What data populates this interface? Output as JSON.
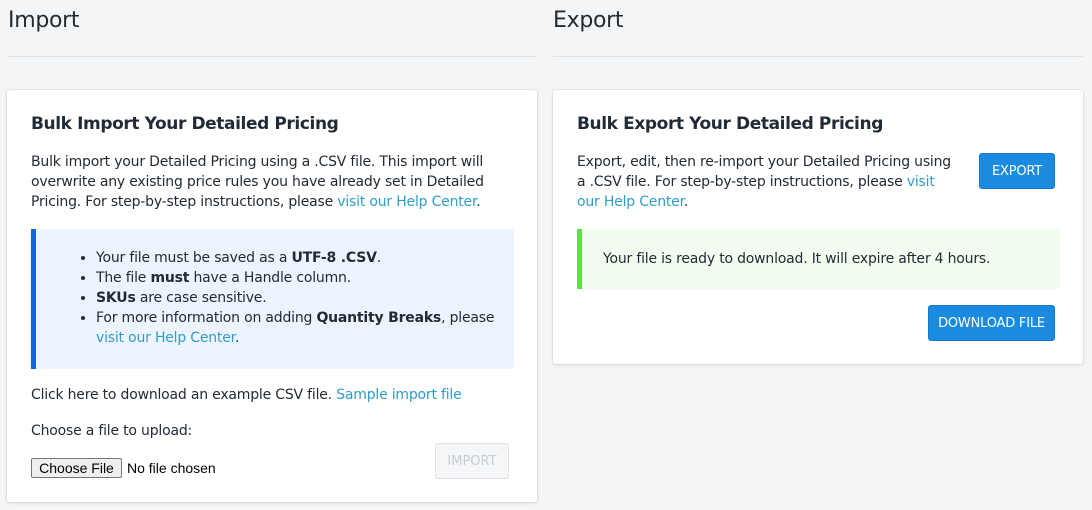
{
  "import": {
    "section_title": "Import",
    "card_title": "Bulk Import Your Detailed Pricing",
    "intro_text": "Bulk import your Detailed Pricing using a .CSV file. This import will overwrite any existing price rules you have already set in Detailed Pricing. For step-by-step instructions, please ",
    "intro_link": "visit our Help Center",
    "intro_end": ".",
    "bullets": {
      "b1_pre": "Your file must be saved as a ",
      "b1_bold": "UTF-8 .CSV",
      "b1_post": ".",
      "b2_pre": "The file ",
      "b2_bold": "must",
      "b2_post": " have a Handle column.",
      "b3_bold": "SKUs",
      "b3_post": " are case sensitive.",
      "b4_pre": "For more information on adding ",
      "b4_bold": "Quantity Breaks",
      "b4_post": ", please ",
      "b4_link": "visit our Help Center",
      "b4_end": "."
    },
    "sample_text": "Click here to download an example CSV file. ",
    "sample_link": "Sample import file",
    "upload_label": "Choose a file to upload:",
    "choose_file_label": "Choose File",
    "file_status": "No file chosen",
    "import_button": "IMPORT"
  },
  "export": {
    "section_title": "Export",
    "card_title": "Bulk Export Your Detailed Pricing",
    "intro_text": "Export, edit, then re-import your Detailed Pricing using a .CSV file. For step-by-step instructions, please ",
    "intro_link": "visit our Help Center",
    "intro_end": ".",
    "export_button": "EXPORT",
    "ready_message": "Your file is ready to download. It will expire after 4 hours.",
    "download_button": "DOWNLOAD FILE"
  },
  "colors": {
    "primary": "#1b8be0",
    "link": "#2e9ec9",
    "info_border": "#1266d4",
    "success_border": "#5ce043"
  }
}
